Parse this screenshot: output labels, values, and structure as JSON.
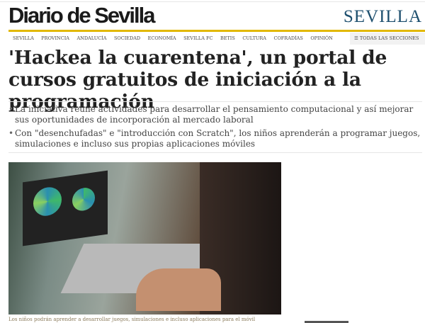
{
  "header": {
    "logo": "Diario de Sevilla",
    "section": "SEVILLA"
  },
  "nav": {
    "items": [
      "SEVILLA",
      "PROVINCIA",
      "ANDALUCÍA",
      "SOCIEDAD",
      "ECONOMÍA",
      "SEVILLA FC",
      "BETIS",
      "CULTURA",
      "COFRADÍAS",
      "OPINIÓN"
    ],
    "all_sections": "TODAS LAS SECCIONES"
  },
  "article": {
    "title": "'Hackea la cuarentena', un portal de cursos gratuitos de iniciación a la programación",
    "bullets": [
      "La iniciativa reúne actividades para desarrollar el pensamiento computacional y así mejorar sus oportunidades de incorporación al mercado laboral",
      "Con \"desenchufadas\" e \"introducción con Scratch\", los niños aprenderán a programar juegos, simulaciones e incluso sus propias aplicaciones móviles"
    ],
    "caption": "Los niños podrán aprender a desarrollar juegos, simulaciones e incluso aplicaciones para el móvil"
  }
}
